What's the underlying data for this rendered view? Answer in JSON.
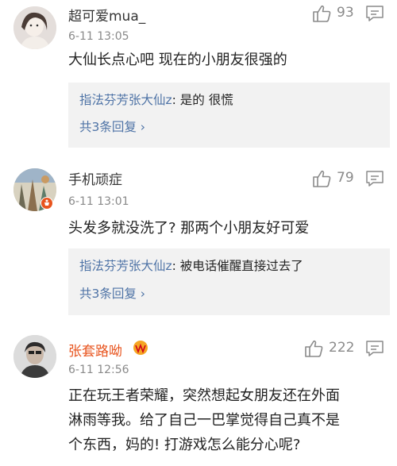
{
  "comments": [
    {
      "username": "超可爱mua_",
      "time": "6-11 13:05",
      "likes": "93",
      "text": "大仙长点心吧 现在的小朋友很强的",
      "reply": {
        "user": "指法芬芳张大仙z",
        "sep": ":",
        "text": " 是的 很慌"
      },
      "more": "共3条回复 ›"
    },
    {
      "username": "手机顽症",
      "time": "6-11 13:01",
      "likes": "79",
      "text": "头发多就没洗了? 那两个小朋友好可爱",
      "reply": {
        "user": "指法芬芳张大仙z",
        "sep": ":",
        "text": " 被电话催醒直接过去了"
      },
      "more": "共3条回复 ›"
    },
    {
      "username": "张套路呦",
      "time": "6-11 12:56",
      "likes": "222",
      "text_lines": [
        "正在玩王者荣耀，突然想起女朋友还在外面",
        "淋雨等我。给了自己一巴掌觉得自己真不是",
        "个东西，妈的! 打游戏怎么能分心呢?"
      ]
    }
  ],
  "colors": {
    "link": "#4e73a6",
    "muted": "#8a8a8a",
    "vip_name": "#e8541e",
    "reply_bg": "#f2f2f2"
  }
}
